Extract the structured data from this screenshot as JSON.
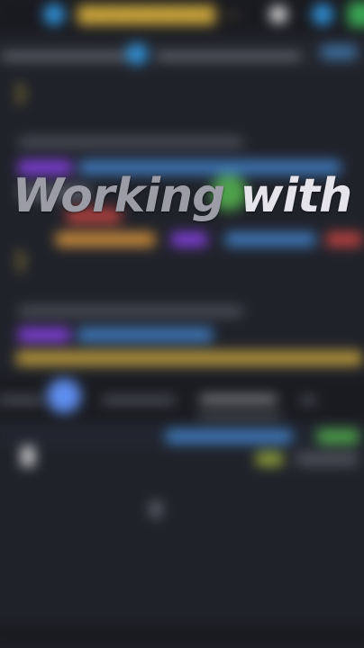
{
  "overlay": {
    "caption_word_1": "Working",
    "caption_word_2": "with"
  },
  "colors": {
    "background": "#20222a",
    "caption_primary": "#9b9ca6",
    "caption_secondary": "#e4e4ea",
    "accent_blue": "#2f8fd6",
    "accent_yellow": "#c9a43a",
    "accent_purple": "#7e3fd6",
    "accent_green": "#3aa655"
  }
}
